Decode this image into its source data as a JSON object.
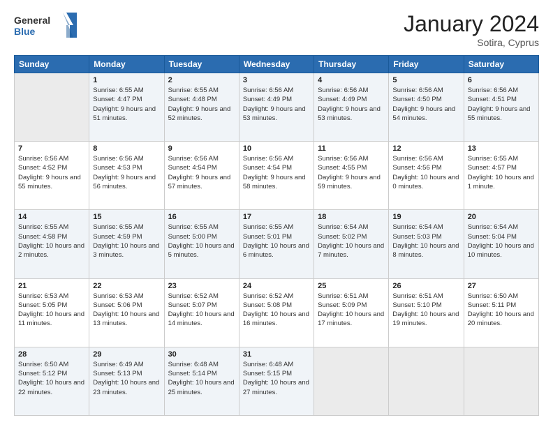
{
  "header": {
    "logo_line1": "General",
    "logo_line2": "Blue",
    "month": "January 2024",
    "location": "Sotira, Cyprus"
  },
  "weekdays": [
    "Sunday",
    "Monday",
    "Tuesday",
    "Wednesday",
    "Thursday",
    "Friday",
    "Saturday"
  ],
  "rows": [
    [
      {
        "day": "",
        "info": ""
      },
      {
        "day": "1",
        "info": "Sunrise: 6:55 AM\nSunset: 4:47 PM\nDaylight: 9 hours\nand 51 minutes."
      },
      {
        "day": "2",
        "info": "Sunrise: 6:55 AM\nSunset: 4:48 PM\nDaylight: 9 hours\nand 52 minutes."
      },
      {
        "day": "3",
        "info": "Sunrise: 6:56 AM\nSunset: 4:49 PM\nDaylight: 9 hours\nand 53 minutes."
      },
      {
        "day": "4",
        "info": "Sunrise: 6:56 AM\nSunset: 4:49 PM\nDaylight: 9 hours\nand 53 minutes."
      },
      {
        "day": "5",
        "info": "Sunrise: 6:56 AM\nSunset: 4:50 PM\nDaylight: 9 hours\nand 54 minutes."
      },
      {
        "day": "6",
        "info": "Sunrise: 6:56 AM\nSunset: 4:51 PM\nDaylight: 9 hours\nand 55 minutes."
      }
    ],
    [
      {
        "day": "7",
        "info": "Sunrise: 6:56 AM\nSunset: 4:52 PM\nDaylight: 9 hours\nand 55 minutes."
      },
      {
        "day": "8",
        "info": "Sunrise: 6:56 AM\nSunset: 4:53 PM\nDaylight: 9 hours\nand 56 minutes."
      },
      {
        "day": "9",
        "info": "Sunrise: 6:56 AM\nSunset: 4:54 PM\nDaylight: 9 hours\nand 57 minutes."
      },
      {
        "day": "10",
        "info": "Sunrise: 6:56 AM\nSunset: 4:54 PM\nDaylight: 9 hours\nand 58 minutes."
      },
      {
        "day": "11",
        "info": "Sunrise: 6:56 AM\nSunset: 4:55 PM\nDaylight: 9 hours\nand 59 minutes."
      },
      {
        "day": "12",
        "info": "Sunrise: 6:56 AM\nSunset: 4:56 PM\nDaylight: 10 hours\nand 0 minutes."
      },
      {
        "day": "13",
        "info": "Sunrise: 6:55 AM\nSunset: 4:57 PM\nDaylight: 10 hours\nand 1 minute."
      }
    ],
    [
      {
        "day": "14",
        "info": "Sunrise: 6:55 AM\nSunset: 4:58 PM\nDaylight: 10 hours\nand 2 minutes."
      },
      {
        "day": "15",
        "info": "Sunrise: 6:55 AM\nSunset: 4:59 PM\nDaylight: 10 hours\nand 3 minutes."
      },
      {
        "day": "16",
        "info": "Sunrise: 6:55 AM\nSunset: 5:00 PM\nDaylight: 10 hours\nand 5 minutes."
      },
      {
        "day": "17",
        "info": "Sunrise: 6:55 AM\nSunset: 5:01 PM\nDaylight: 10 hours\nand 6 minutes."
      },
      {
        "day": "18",
        "info": "Sunrise: 6:54 AM\nSunset: 5:02 PM\nDaylight: 10 hours\nand 7 minutes."
      },
      {
        "day": "19",
        "info": "Sunrise: 6:54 AM\nSunset: 5:03 PM\nDaylight: 10 hours\nand 8 minutes."
      },
      {
        "day": "20",
        "info": "Sunrise: 6:54 AM\nSunset: 5:04 PM\nDaylight: 10 hours\nand 10 minutes."
      }
    ],
    [
      {
        "day": "21",
        "info": "Sunrise: 6:53 AM\nSunset: 5:05 PM\nDaylight: 10 hours\nand 11 minutes."
      },
      {
        "day": "22",
        "info": "Sunrise: 6:53 AM\nSunset: 5:06 PM\nDaylight: 10 hours\nand 13 minutes."
      },
      {
        "day": "23",
        "info": "Sunrise: 6:52 AM\nSunset: 5:07 PM\nDaylight: 10 hours\nand 14 minutes."
      },
      {
        "day": "24",
        "info": "Sunrise: 6:52 AM\nSunset: 5:08 PM\nDaylight: 10 hours\nand 16 minutes."
      },
      {
        "day": "25",
        "info": "Sunrise: 6:51 AM\nSunset: 5:09 PM\nDaylight: 10 hours\nand 17 minutes."
      },
      {
        "day": "26",
        "info": "Sunrise: 6:51 AM\nSunset: 5:10 PM\nDaylight: 10 hours\nand 19 minutes."
      },
      {
        "day": "27",
        "info": "Sunrise: 6:50 AM\nSunset: 5:11 PM\nDaylight: 10 hours\nand 20 minutes."
      }
    ],
    [
      {
        "day": "28",
        "info": "Sunrise: 6:50 AM\nSunset: 5:12 PM\nDaylight: 10 hours\nand 22 minutes."
      },
      {
        "day": "29",
        "info": "Sunrise: 6:49 AM\nSunset: 5:13 PM\nDaylight: 10 hours\nand 23 minutes."
      },
      {
        "day": "30",
        "info": "Sunrise: 6:48 AM\nSunset: 5:14 PM\nDaylight: 10 hours\nand 25 minutes."
      },
      {
        "day": "31",
        "info": "Sunrise: 6:48 AM\nSunset: 5:15 PM\nDaylight: 10 hours\nand 27 minutes."
      },
      {
        "day": "",
        "info": ""
      },
      {
        "day": "",
        "info": ""
      },
      {
        "day": "",
        "info": ""
      }
    ]
  ]
}
